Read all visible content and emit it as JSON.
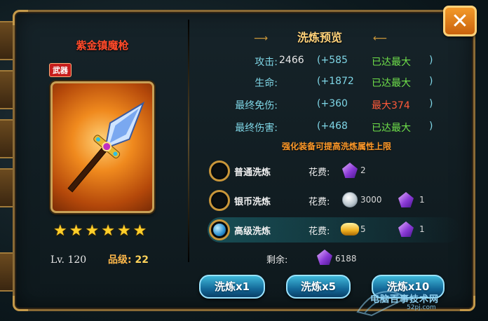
{
  "close_button": {
    "label": "✕"
  },
  "item": {
    "name": "紫金镇魔枪",
    "type_badge": "武器",
    "stars": 6,
    "level": "Lv. 120",
    "grade_label": "品级:",
    "grade_value": "22"
  },
  "refine": {
    "title": "洗炼预览",
    "stats": [
      {
        "label": "攻击:",
        "value": "2466",
        "bonus": "(+585",
        "status": "已达最大",
        "status_type": "max",
        "close": ")"
      },
      {
        "label": "生命:",
        "value": "",
        "bonus": "(+1872",
        "status": "已达最大",
        "status_type": "max",
        "close": ")"
      },
      {
        "label": "最终免伤:",
        "value": "",
        "bonus": "(+360",
        "status": "最大374",
        "status_type": "limit",
        "close": ")"
      },
      {
        "label": "最终伤害:",
        "value": "",
        "bonus": "(+468",
        "status": "已达最大",
        "status_type": "max",
        "close": ")"
      }
    ],
    "hint": "强化装备可提高洗炼属性上限",
    "options": [
      {
        "label": "普通洗炼",
        "cost_label": "花费:",
        "cost1_icon": "purple-gem-icon",
        "cost1": "2",
        "cost2_icon": "",
        "cost2": "",
        "selected": false
      },
      {
        "label": "银币洗炼",
        "cost_label": "花费:",
        "cost1_icon": "silver-coin-icon",
        "cost1": "3000",
        "cost2_icon": "purple-gem-icon",
        "cost2": "1",
        "selected": false
      },
      {
        "label": "高级洗炼",
        "cost_label": "花费:",
        "cost1_icon": "gold-ingot-icon",
        "cost1": "5",
        "cost2_icon": "purple-gem-icon",
        "cost2": "1",
        "selected": true
      }
    ],
    "remaining_label": "剩余:",
    "remaining_icon": "purple-gem-icon",
    "remaining_value": "6188"
  },
  "buttons": [
    {
      "label": "洗炼x1"
    },
    {
      "label": "洗炼x5"
    },
    {
      "label": "洗炼x10"
    }
  ],
  "watermark": {
    "text": "电脑百事技术网",
    "sub": "52pj.com"
  },
  "colors": {
    "frame_gold": "#8a6a35",
    "label_cyan": "#7fd6e6",
    "status_max": "#6fe04a",
    "status_limit": "#ff5a3a",
    "item_name": "#ff4a2a",
    "button_blue": "#146a9a"
  }
}
